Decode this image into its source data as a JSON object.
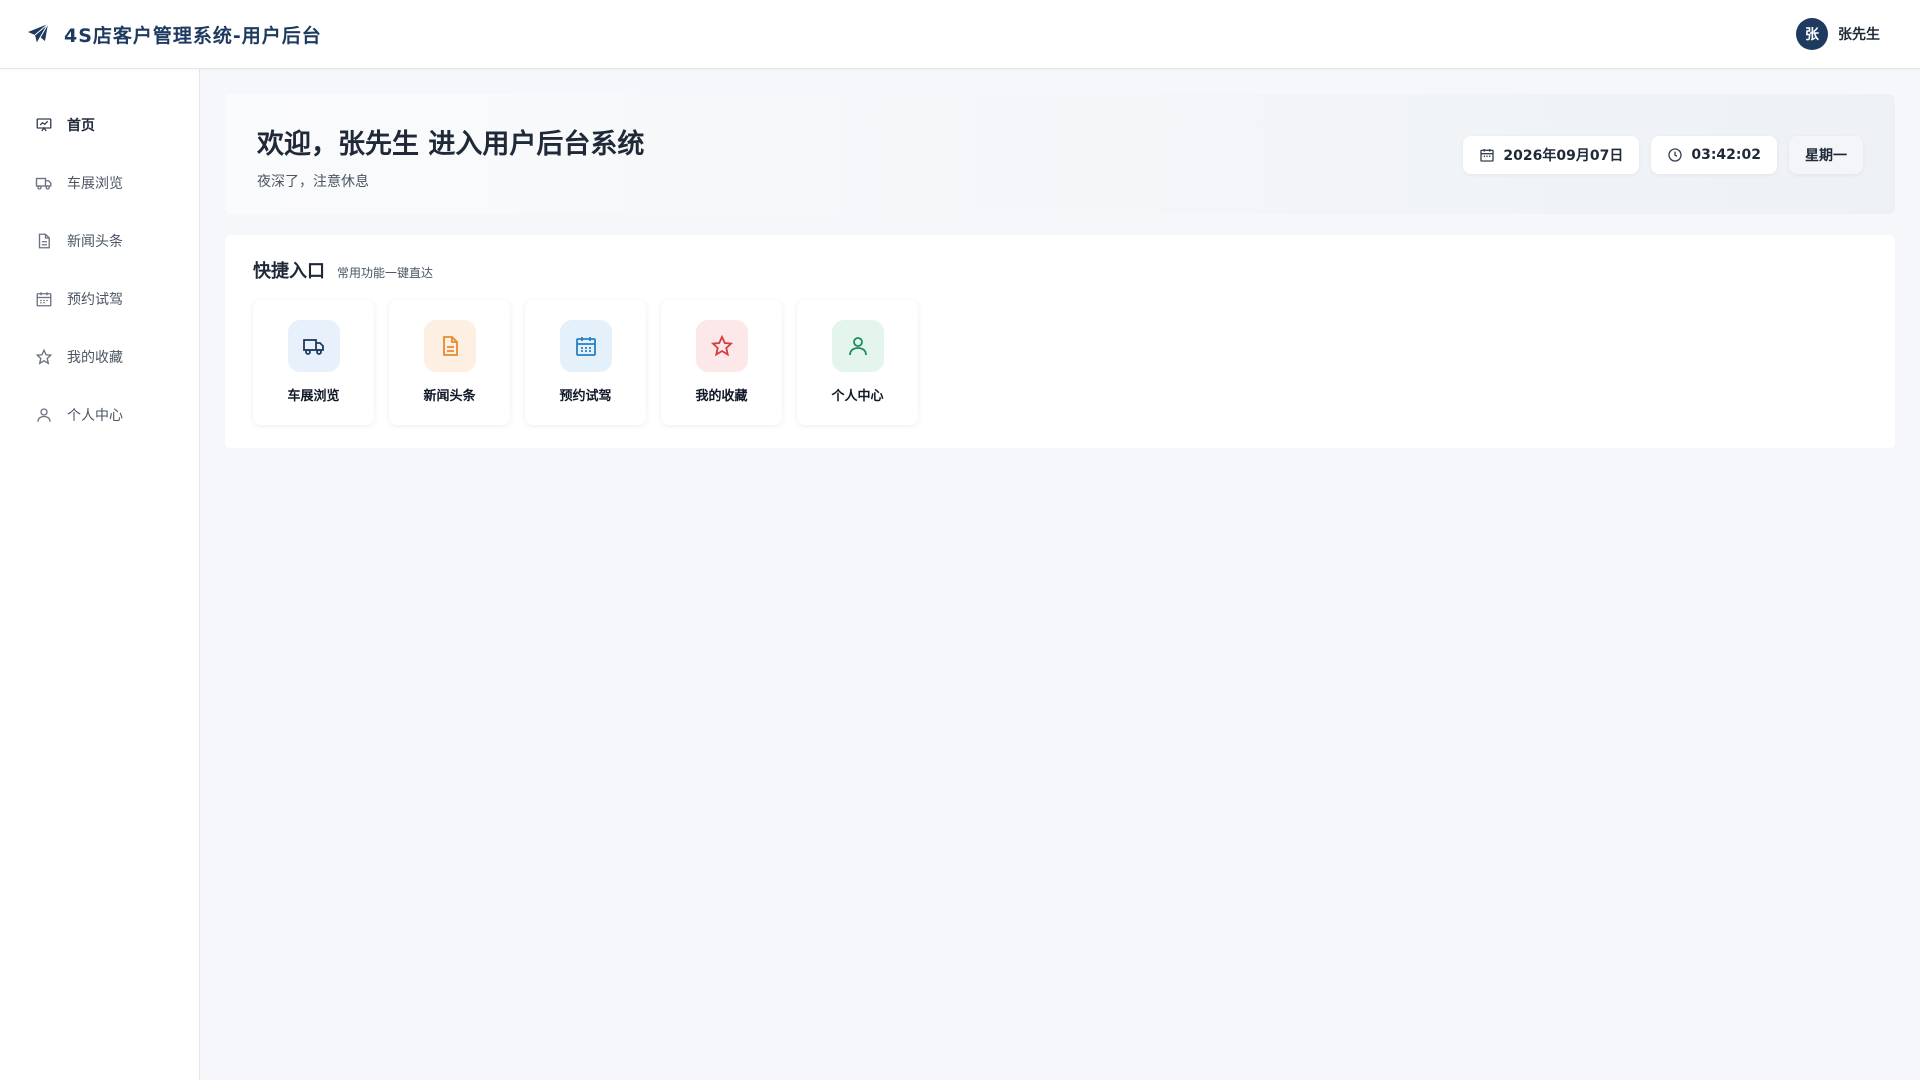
{
  "header": {
    "title": "4S店客户管理系统-用户后台",
    "logo_icon": "paper-plane-icon",
    "user": {
      "avatar_text": "张",
      "name": "张先生"
    }
  },
  "sidebar": {
    "items": [
      {
        "label": "首页",
        "icon": "presentation-icon",
        "active": true
      },
      {
        "label": "车展浏览",
        "icon": "truck-icon",
        "active": false
      },
      {
        "label": "新闻头条",
        "icon": "document-icon",
        "active": false
      },
      {
        "label": "预约试驾",
        "icon": "calendar-icon",
        "active": false
      },
      {
        "label": "我的收藏",
        "icon": "star-icon",
        "active": false
      },
      {
        "label": "个人中心",
        "icon": "user-icon",
        "active": false
      }
    ]
  },
  "welcome": {
    "title": "欢迎，张先生 进入用户后台系统",
    "subtitle": "夜深了，注意休息",
    "date": "2026年09月07日",
    "time": "03:42:02",
    "weekday": "星期一"
  },
  "quick": {
    "title": "快捷入口",
    "subtitle": "常用功能一键直达",
    "cards": [
      {
        "label": "车展浏览",
        "icon": "truck-icon",
        "color": "#1e3a5f",
        "bg": "#e8f1fb"
      },
      {
        "label": "新闻头条",
        "icon": "document-icon",
        "color": "#e8892c",
        "bg": "#fdf0e2"
      },
      {
        "label": "预约试驾",
        "icon": "calendar-icon",
        "color": "#2a7fc1",
        "bg": "#e4f0fa"
      },
      {
        "label": "我的收藏",
        "icon": "star-icon",
        "color": "#d63c3c",
        "bg": "#fce8e8"
      },
      {
        "label": "个人中心",
        "icon": "user-icon",
        "color": "#1f8a5b",
        "bg": "#e3f5ec"
      }
    ]
  },
  "colors": {
    "brand": "#1e3a5f",
    "background": "#f5f7fa"
  }
}
